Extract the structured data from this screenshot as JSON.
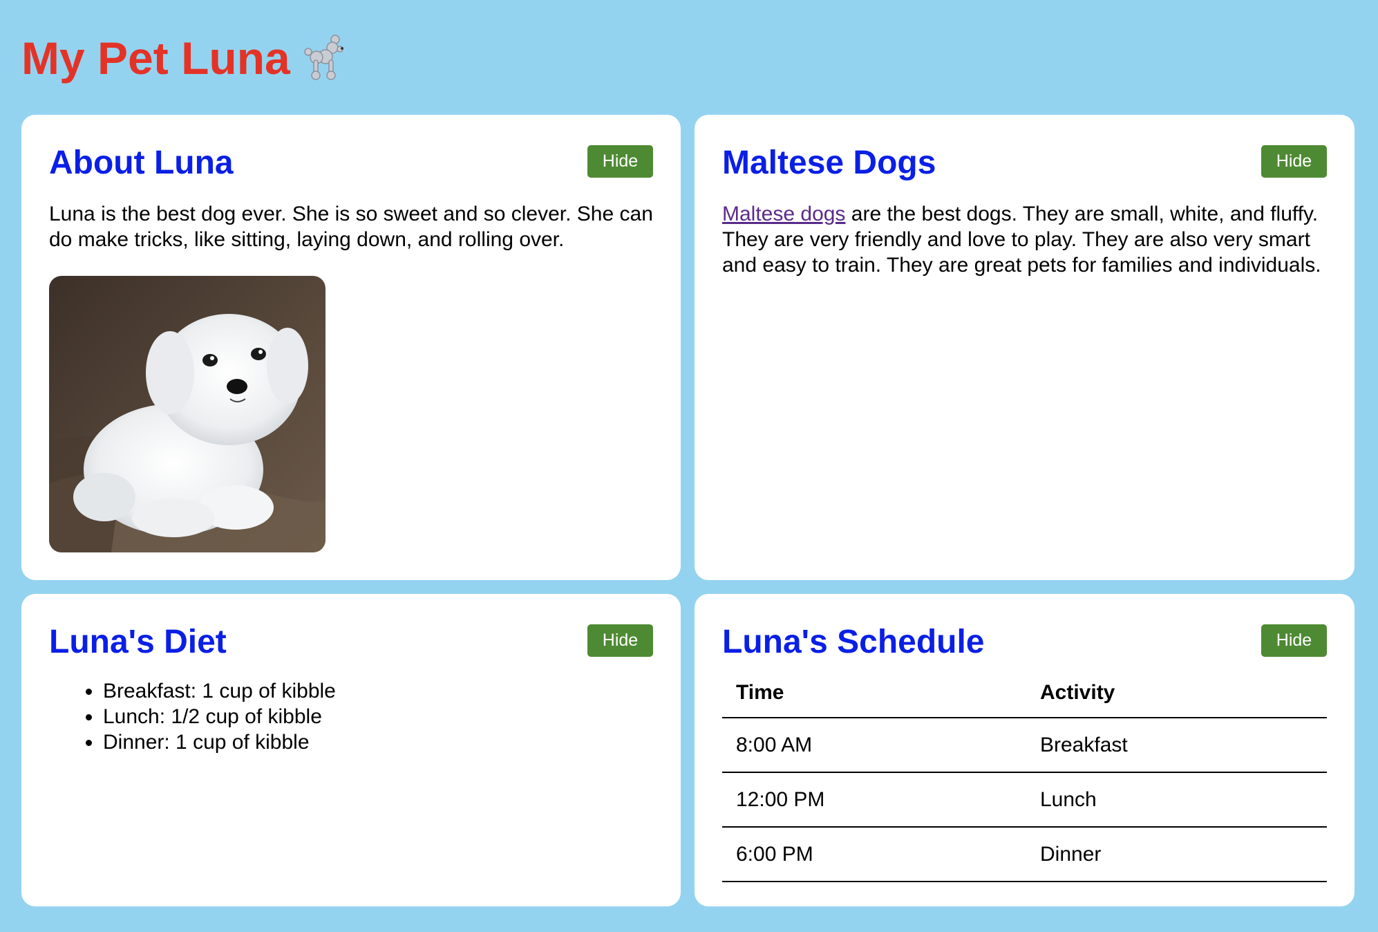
{
  "page": {
    "title": "My Pet Luna",
    "title_icon": "poodle-icon",
    "colors": {
      "background": "#94d3f0",
      "title": "#e33327",
      "card_heading": "#0a1fe6",
      "hide_button": "#4e8a33",
      "link": "#5a2a8a"
    }
  },
  "about": {
    "heading": "About Luna",
    "hide_label": "Hide",
    "text": "Luna is the best dog ever. She is so sweet and so clever. She can do make tricks, like sitting, laying down, and rolling over."
  },
  "maltese": {
    "heading": "Maltese Dogs",
    "hide_label": "Hide",
    "link_text": "Maltese dogs",
    "text": " are the best dogs. They are small, white, and fluffy. They are very friendly and love to play. They are also very smart and easy to train. They are great pets for families and individuals."
  },
  "diet": {
    "heading": "Luna's Diet",
    "hide_label": "Hide",
    "items": [
      "Breakfast: 1 cup of kibble",
      "Lunch: 1/2 cup of kibble",
      "Dinner: 1 cup of kibble"
    ]
  },
  "schedule": {
    "heading": "Luna's Schedule",
    "hide_label": "Hide",
    "columns": [
      "Time",
      "Activity"
    ],
    "rows": [
      [
        "8:00 AM",
        "Breakfast"
      ],
      [
        "12:00 PM",
        "Lunch"
      ],
      [
        "6:00 PM",
        "Dinner"
      ]
    ]
  }
}
